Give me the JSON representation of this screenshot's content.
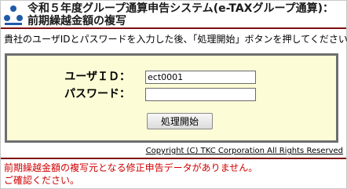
{
  "header": {
    "title_line1": "令和５年度グループ通算申告システム(e-TAXグループ通算)：",
    "title_line2": "前期繰越金額の複写",
    "logo_icon": "tkc-logo-icon",
    "rule_color": "#7f1010"
  },
  "instruction": "貴社のユーザIDとパスワードを入力した後、「処理開始」ボタンを押してください。",
  "login": {
    "user_label": "ユーザＩＤ：",
    "user_value": "ect0001",
    "password_label": "パスワード：",
    "password_value": "",
    "start_button_label": "処理開始",
    "panel_color": "#fcfcd7"
  },
  "copyright": "Copyright (C) TKC Corporation All Rights Reserved",
  "error": {
    "line1": "前期繰越金額の複写元となる修正申告データがありません。",
    "line2": "ご確認ください。",
    "color": "#d00000"
  }
}
